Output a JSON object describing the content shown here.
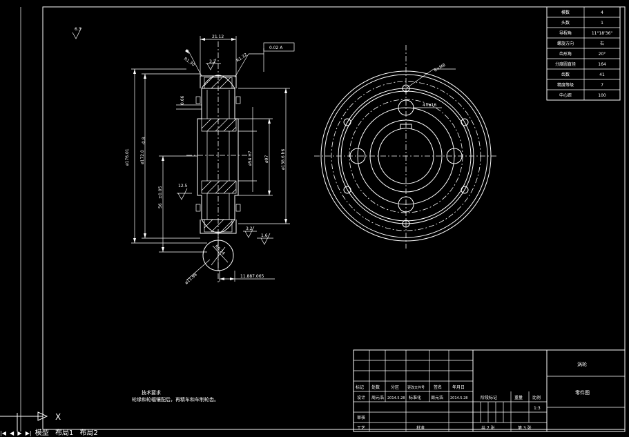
{
  "gear_table": [
    {
      "label": "模数",
      "value": "4"
    },
    {
      "label": "头数",
      "value": "1"
    },
    {
      "label": "导程角",
      "value": "11°18'36\""
    },
    {
      "label": "螺旋方向",
      "value": "右"
    },
    {
      "label": "齿形角",
      "value": "20°"
    },
    {
      "label": "分度圆直径",
      "value": "164"
    },
    {
      "label": "齿数",
      "value": "41"
    },
    {
      "label": "精度等级",
      "value": "7"
    },
    {
      "label": "中心距",
      "value": "100"
    }
  ],
  "dimensions": {
    "width_top": "21.12",
    "r_left": "R1.30",
    "r_right": "R1.32",
    "tolerance_box": "0.02 A",
    "d_outer": "ø176.01",
    "d_tip": "ø172.0",
    "d_tip_tol": "-0.8",
    "length_56": "56",
    "length_tol": "±0.05",
    "d_hub": "ø138.6 h6",
    "d_bore": "ø54 H7",
    "d_97": "ø97",
    "offset": "0.66",
    "r_bottom": "R0.24",
    "d_small": "ø11.98",
    "keyway": "11.887.065",
    "holes_top": "6×M8",
    "holes_mid": "4×ø16",
    "rough_corner": "6.3",
    "rough_1": "12.5",
    "rough_2": "3.2",
    "rough_3": "1.6",
    "rough_4": "3.2"
  },
  "notes": {
    "title": "技术要求",
    "line1": "轮缘和轮辐镶配后，再精车和车制轮齿。"
  },
  "title_block": {
    "part_name": "涡轮",
    "drawing_type": "零件图",
    "headers": [
      "标记",
      "处数",
      "分区",
      "更改文件号",
      "签名",
      "年月日"
    ],
    "design_label": "设计",
    "designer": "周元浩",
    "design_date": "2014.5.28",
    "std_label": "标准化",
    "std_name": "周元浩",
    "std_date": "2014.5.28",
    "stage_label": "阶段标记",
    "weight_label": "重量",
    "scale_label": "比例",
    "scale_value": "1:3",
    "review_label": "审核",
    "craft_label": "工艺",
    "approve_label": "批准",
    "sheets_total": "共 7 张",
    "sheet_no": "第 3 张"
  },
  "tabs": {
    "nav_glyphs": [
      "|◀",
      "◀",
      "▶",
      "▶|"
    ],
    "model": "模型",
    "layout1": "布局1",
    "layout2": "布局2"
  },
  "axis_label": "X"
}
